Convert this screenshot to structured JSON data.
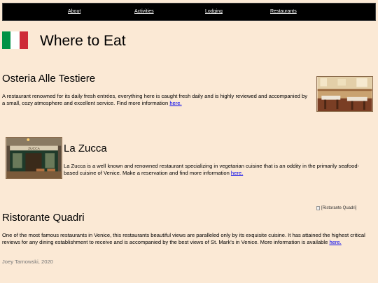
{
  "nav": {
    "links": [
      "About",
      "Activities",
      "Lodging",
      "Restaurants"
    ]
  },
  "page": {
    "title": "Where to Eat"
  },
  "restaurants": [
    {
      "name": "Osteria Alle Testiere",
      "description": "A restaurant renowned for its daily fresh entrées, everything here is caught fresh daily and is highly reviewed and accompanied by a small, cozy atmosphere and excellent service. Find more information ",
      "link": "here."
    },
    {
      "name": "La Zucca",
      "description": "La Zucca is a well known and renowned restaurant specializing in vegetarian cuisine that is an oddity in the primarily seafood-based cuisine of Venice. Make a reservation and find more information ",
      "link": "here.",
      "sign": "ZUCCA"
    },
    {
      "name": "Ristorante Quadri",
      "description": "One of the most famous restaurants in Venice, this restaurants beautiful views are paralleled only by its exquisite cuisine. It has attained the highest critical reviews for any dining establishment to receive and is accompanied by the best views of St. Mark's in Venice. More information is available ",
      "link": "here.",
      "image_alt": "[Ristorante Quadri]"
    }
  ],
  "footer": {
    "text": "Joey Tarnowski, 2020"
  },
  "colors": {
    "background": "#fbe9d5",
    "nav": "#000000",
    "link": "#0000ee",
    "flag": [
      "#009246",
      "#ffffff",
      "#ce2b37"
    ]
  }
}
